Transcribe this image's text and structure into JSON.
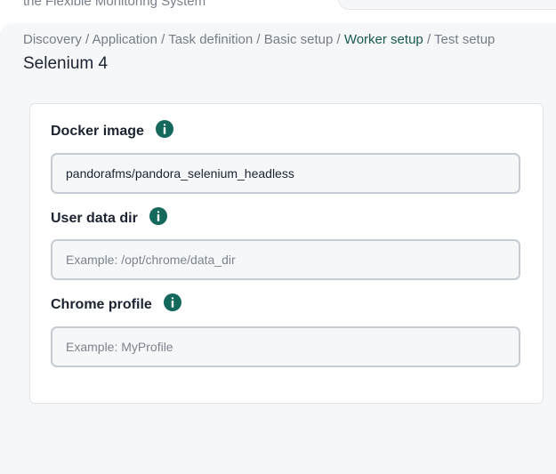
{
  "header": {
    "tagline": "the Flexible Monitoring System"
  },
  "breadcrumb": {
    "items": [
      {
        "label": "Discovery",
        "current": false
      },
      {
        "label": "Application",
        "current": false
      },
      {
        "label": "Task definition",
        "current": false
      },
      {
        "label": "Basic setup",
        "current": false
      },
      {
        "label": "Worker setup",
        "current": true
      },
      {
        "label": "Test setup",
        "current": false
      }
    ],
    "separator": "/"
  },
  "page": {
    "title": "Selenium 4"
  },
  "form": {
    "docker_image": {
      "label": "Docker image",
      "value": "pandorafms/pandora_selenium_headless",
      "placeholder": ""
    },
    "user_data_dir": {
      "label": "User data dir",
      "value": "",
      "placeholder": "Example: /opt/chrome/data_dir"
    },
    "chrome_profile": {
      "label": "Chrome profile",
      "value": "",
      "placeholder": "Example: MyProfile"
    }
  },
  "colors": {
    "accent": "#14695c",
    "breadcrumb_current": "#1a5a52",
    "content_background": "#f5f7f9"
  },
  "icons": {
    "info": "info-icon"
  }
}
